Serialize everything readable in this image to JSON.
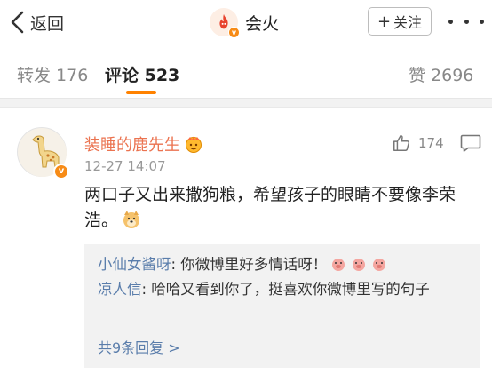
{
  "nav": {
    "back_label": "返回",
    "account_name": "会火",
    "follow_label": "关注"
  },
  "tabs": {
    "repost": "转发 176",
    "comments": "评论 523",
    "likes": "赞 2696"
  },
  "comment": {
    "author": "装睡的鹿先生",
    "time": "12-27 14:07",
    "like_count": "174",
    "text": "两口子又出来撒狗粮，希望孩子的眼睛不要像李荣浩。"
  },
  "replies": {
    "items": [
      {
        "name": "小仙女酱呀",
        "text": ": 你微博里好多情话呀！"
      },
      {
        "name": "凉人信",
        "text": ": 哈哈又看到你了，挺喜欢你微博里写的句子"
      }
    ],
    "more_label": "共9条回复 >"
  },
  "colors": {
    "accent": "#ff8200",
    "username": "#eb7350",
    "link": "#5a7dab",
    "verified_badge": "#f78b16"
  },
  "icons": {
    "back": "chevron-left-icon",
    "avatar": "fire-avatar-icon",
    "more": "more-dots-icon",
    "like": "thumbs-up-icon",
    "reply": "comment-bubble-icon",
    "emoji_doge": "doge-emoji-icon",
    "emoji_pig": "pig-emoji-icon"
  }
}
